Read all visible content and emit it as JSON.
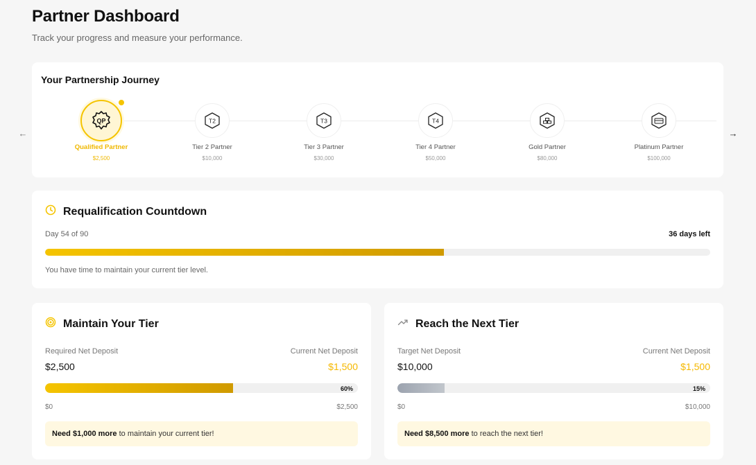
{
  "header": {
    "title": "Partner Dashboard",
    "subtitle": "Track your progress and measure your performance."
  },
  "journey": {
    "title": "Your Partnership Journey",
    "tiers": [
      {
        "badge": "QP",
        "name": "Qualified Partner",
        "amount": "$2,500",
        "active": true,
        "icon": "qp-badge-icon"
      },
      {
        "badge": "T2",
        "name": "Tier 2 Partner",
        "amount": "$10,000",
        "active": false,
        "icon": "t2-badge-icon"
      },
      {
        "badge": "T3",
        "name": "Tier 3 Partner",
        "amount": "$30,000",
        "active": false,
        "icon": "t3-badge-icon"
      },
      {
        "badge": "T4",
        "name": "Tier 4 Partner",
        "amount": "$50,000",
        "active": false,
        "icon": "t4-badge-icon"
      },
      {
        "badge": "",
        "name": "Gold Partner",
        "amount": "$80,000",
        "active": false,
        "icon": "gold-bars-icon"
      },
      {
        "badge": "",
        "name": "Platinum Partner",
        "amount": "$100,000",
        "active": false,
        "icon": "platinum-card-icon"
      }
    ],
    "prev_icon": "arrow-left-icon",
    "next_icon": "arrow-right-icon"
  },
  "countdown": {
    "title": "Requalification Countdown",
    "day_label": "Day 54 of 90",
    "days_left": "36 days left",
    "progress": 0.6,
    "hint": "You have time to maintain your current tier level.",
    "icon": "clock-icon"
  },
  "maintain": {
    "title": "Maintain Your Tier",
    "required_label": "Required Net Deposit",
    "required_value": "$2,500",
    "current_label": "Current Net Deposit",
    "current_value": "$1,500",
    "progress": 0.6,
    "percent_label": "60%",
    "scale_min": "$0",
    "scale_max": "$2,500",
    "note_bold": "Need $1,000 more",
    "note_rest": " to maintain your current tier!",
    "icon": "target-icon"
  },
  "next": {
    "title": "Reach the Next Tier",
    "target_label": "Target Net Deposit",
    "target_value": "$10,000",
    "current_label": "Current Net Deposit",
    "current_value": "$1,500",
    "progress": 0.15,
    "percent_label": "15%",
    "scale_min": "$0",
    "scale_max": "$10,000",
    "note_bold": "Need $8,500 more",
    "note_rest": " to reach the next tier!",
    "icon": "trending-up-icon"
  },
  "colors": {
    "accent": "#f5c400",
    "accent_dark": "#d09a00",
    "gray_fill": "#9ca3af",
    "note_bg": "#fff8e1"
  }
}
